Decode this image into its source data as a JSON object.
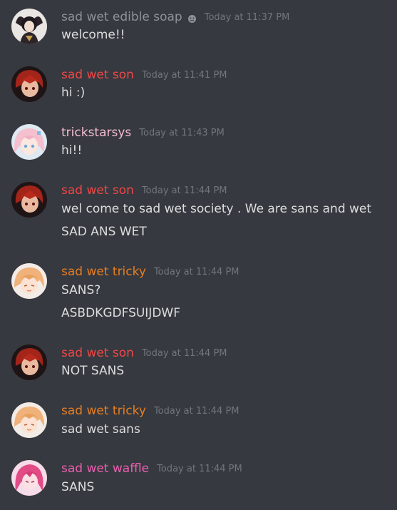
{
  "colors": {
    "background": "#36393f",
    "text": "#dcddde",
    "timestamp": "#72767d",
    "edible_soap": "#8e9297",
    "son": "#f04747",
    "trickstarsys": "#f7bdd3",
    "tricky": "#e67e22",
    "waffle": "#eb5fb0"
  },
  "messages": [
    {
      "user": "sad wet edible soap",
      "time": "Today at 11:37 PM",
      "lines": [
        "welcome!!"
      ]
    },
    {
      "user": "sad wet son",
      "time": "Today at 11:41 PM",
      "lines": [
        "hi :)"
      ]
    },
    {
      "user": "trickstarsys",
      "time": "Today at 11:43 PM",
      "lines": [
        "hi!!"
      ]
    },
    {
      "user": "sad wet son",
      "time": "Today at 11:44 PM",
      "lines": [
        "wel come to sad wet society . We are sans and wet",
        "SAD ANS WET"
      ]
    },
    {
      "user": "sad wet tricky",
      "time": "Today at 11:44 PM",
      "lines": [
        "SANS?",
        "ASBDKGDFSUIJDWF"
      ]
    },
    {
      "user": "sad wet son",
      "time": "Today at 11:44 PM",
      "lines": [
        "NOT SANS"
      ]
    },
    {
      "user": "sad wet tricky",
      "time": "Today at 11:44 PM",
      "lines": [
        "sad wet sans"
      ]
    },
    {
      "user": "sad wet waffle",
      "time": "Today at 11:44 PM",
      "lines": [
        "SANS"
      ]
    }
  ]
}
